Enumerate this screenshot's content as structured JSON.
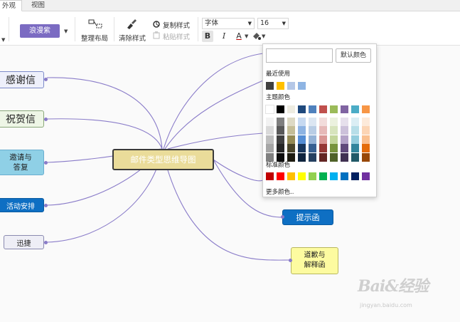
{
  "tabs": [
    {
      "label": "外观",
      "active": true
    },
    {
      "label": "视图",
      "active": false
    }
  ],
  "ribbon": {
    "theme_label": "浪漫紫",
    "tidy_layout": "整理布局",
    "clear_style": "清除样式",
    "copy_style": "复制样式",
    "paste_style": "粘贴样式",
    "font_family": "字体",
    "font_size": "16",
    "bold": "B",
    "italic": "I",
    "font_color": "A"
  },
  "mindmap": {
    "central": "邮件类型思维导图",
    "left_nodes": [
      "感谢信",
      "祝贺信",
      "邀请与\n答复",
      "活动安排",
      "迅捷"
    ],
    "right_nodes": [
      "提示函",
      "道歉与\n解释函"
    ]
  },
  "color_picker": {
    "hex_value": "",
    "default_button": "默认颜色",
    "recent_title": "最近使用",
    "recent_colors": [
      "#404040",
      "#ffc000",
      "#b4c7e7",
      "#8eb4e3"
    ],
    "theme_title": "主题颜色",
    "theme_columns": [
      [
        "#ffffff",
        "#f2f2f2",
        "#d9d9d9",
        "#bfbfbf",
        "#a6a6a6",
        "#808080"
      ],
      [
        "#000000",
        "#7f7f7f",
        "#595959",
        "#404040",
        "#262626",
        "#0d0d0d"
      ],
      [
        "#eeece1",
        "#ddd9c4",
        "#c4bd97",
        "#948a54",
        "#4a452a",
        "#1e1c11"
      ],
      [
        "#1f497d",
        "#c6d9f1",
        "#8db3e2",
        "#548dd4",
        "#17365d",
        "#0f243e"
      ],
      [
        "#4f81bd",
        "#dce6f2",
        "#b9cde5",
        "#95b3d7",
        "#376092",
        "#254061"
      ],
      [
        "#c0504d",
        "#f2dcdb",
        "#e6b9b8",
        "#d99694",
        "#953735",
        "#632523"
      ],
      [
        "#9bbb59",
        "#ebf1de",
        "#d7e4bd",
        "#c3d69b",
        "#77933c",
        "#4f6228"
      ],
      [
        "#8064a2",
        "#e6e0ec",
        "#ccc1da",
        "#b3a2c7",
        "#604a7b",
        "#403152"
      ],
      [
        "#4bacc6",
        "#dbeef4",
        "#b7dee8",
        "#93cddd",
        "#31859c",
        "#215968"
      ],
      [
        "#f79646",
        "#fdeada",
        "#fcd5b5",
        "#fac090",
        "#e46c0a",
        "#984807"
      ]
    ],
    "standard_title": "标准颜色",
    "standard_colors": [
      "#c00000",
      "#ff0000",
      "#ffc000",
      "#ffff00",
      "#92d050",
      "#00b050",
      "#00b0f0",
      "#0070c0",
      "#002060",
      "#7030a0"
    ],
    "more_colors": "更多颜色.."
  },
  "watermark": {
    "logo": "Bai&经验",
    "url": "jingyan.baidu.com"
  },
  "colors": {
    "accent_purple": "#7b6bc2",
    "connector": "#8a7cc9"
  }
}
